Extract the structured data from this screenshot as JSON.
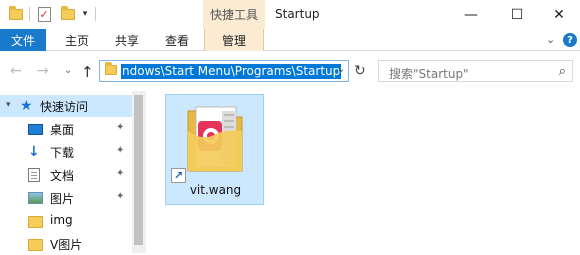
{
  "window": {
    "title": "Startup",
    "contextual_tab": "快捷工具",
    "controls": [
      "—",
      "☐",
      "✕"
    ]
  },
  "quick_access_toolbar": {
    "dropdown_glyph": "▾"
  },
  "ribbon": {
    "tabs": [
      "文件",
      "主页",
      "共享",
      "查看",
      "管理"
    ],
    "expand_glyph": "⌄",
    "help_glyph": "?"
  },
  "navigation": {
    "back": "←",
    "forward": "→",
    "recent": "⌄",
    "up": "↑",
    "address": "ndows\\Start Menu\\Programs\\Startup",
    "address_dropdown": "⌄",
    "refresh": "↻",
    "search_placeholder": "搜索\"Startup\"",
    "search_glyph": "⌕"
  },
  "sidebar": {
    "items": [
      {
        "label": "快速访问",
        "icon": "star-icon",
        "pinned": false
      },
      {
        "label": "桌面",
        "icon": "desktop-icon",
        "pinned": true
      },
      {
        "label": "下载",
        "icon": "download-icon",
        "pinned": true
      },
      {
        "label": "文档",
        "icon": "document-icon",
        "pinned": true
      },
      {
        "label": "图片",
        "icon": "pictures-icon",
        "pinned": true
      },
      {
        "label": "img",
        "icon": "folder-icon",
        "pinned": false
      },
      {
        "label": "V图片",
        "icon": "folder-icon",
        "pinned": false
      }
    ],
    "pin_glyph": "✦"
  },
  "content": {
    "files": [
      {
        "name": "vit.wang",
        "type": "shortcut",
        "selected": true
      }
    ]
  },
  "colors": {
    "accent": "#1979ca",
    "selection": "#cce8ff",
    "contextual_tab_bg": "#fcebd3",
    "folder_yellow": "#f3cc5a"
  }
}
